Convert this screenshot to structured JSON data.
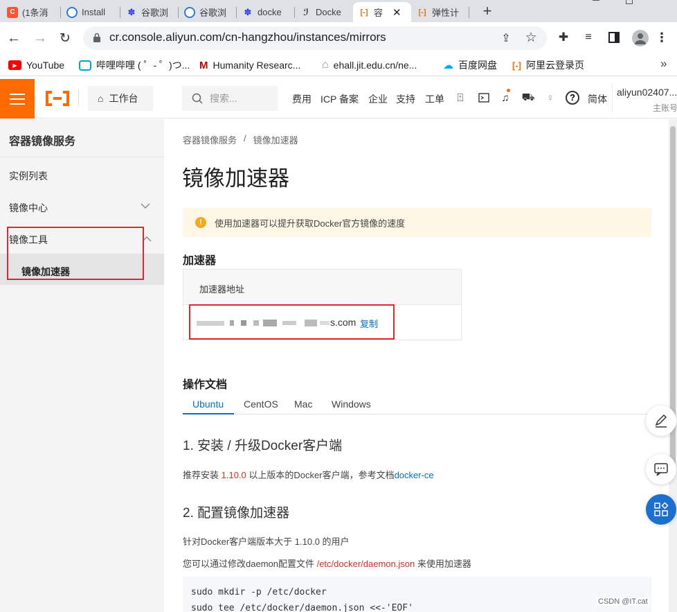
{
  "browser": {
    "tabs": [
      {
        "label": "(1条消",
        "favicon": "csdn-icon",
        "color": "#fc5531"
      },
      {
        "label": "Install",
        "favicon": "edge-icon",
        "color": "#2b7bd5"
      },
      {
        "label": "谷歌浏",
        "favicon": "baidu-paw-icon",
        "color": "#2932e1"
      },
      {
        "label": "谷歌浏",
        "favicon": "edge-icon",
        "color": "#2b7bd5"
      },
      {
        "label": "docke",
        "favicon": "baidu-paw-icon",
        "color": "#2932e1"
      },
      {
        "label": "Docke",
        "favicon": "scribble-icon",
        "color": "#444"
      },
      {
        "label": "容",
        "favicon": "aliyun-icon",
        "color": "#ff6a00"
      },
      {
        "label": "弹性计",
        "favicon": "aliyun-icon",
        "color": "#ff6a00"
      }
    ],
    "url": "cr.console.aliyun.com/cn-hangzhou/instances/mirrors",
    "bookmarks": [
      {
        "label": "YouTube",
        "icon": "youtube-icon"
      },
      {
        "label": "哔哩哔哩 ( ゜- ゜)つ...",
        "icon": "bilibili-icon"
      },
      {
        "label": "Humanity Researc...",
        "icon": "humanity-icon"
      },
      {
        "label": "ehall.jit.edu.cn/ne...",
        "icon": "campus-icon"
      },
      {
        "label": "百度网盘",
        "icon": "baidu-netdisk-icon"
      },
      {
        "label": "阿里云登录页",
        "icon": "aliyun-icon"
      }
    ],
    "bookmarks_more": "»",
    "new_tab": "+"
  },
  "topbar": {
    "workbench": "工作台",
    "search_placeholder": "搜索...",
    "nav": [
      "费用",
      "ICP 备案",
      "企业",
      "支持",
      "工单"
    ],
    "lang": "简体",
    "user_name": "aliyun02407...",
    "user_role": "主账号"
  },
  "sidebar": {
    "title": "容器镜像服务",
    "items": [
      {
        "label": "实例列表"
      },
      {
        "label": "镜像中心"
      },
      {
        "label": "镜像工具"
      },
      {
        "label": "镜像加速器"
      }
    ]
  },
  "main": {
    "breadcrumb": [
      "容器镜像服务",
      "/",
      "镜像加速器"
    ],
    "title": "镜像加速器",
    "notice": "使用加速器可以提升获取Docker官方镜像的速度",
    "accel_heading": "加速器",
    "table_header": "加速器地址",
    "address_suffix": "s.com",
    "copy": "复制",
    "docs_heading": "操作文档",
    "tabs": [
      "Ubuntu",
      "CentOS",
      "Mac",
      "Windows"
    ],
    "step1": "1. 安装 / 升级Docker客户端",
    "step1_text_a": "推荐安装 ",
    "step1_version": "1.10.0",
    "step1_text_b": " 以上版本的Docker客户端，参考文档",
    "step1_link": "docker-ce",
    "step2": "2. 配置镜像加速器",
    "step2_text": "针对Docker客户端版本大于 1.10.0 的用户",
    "step2_text2_a": "您可以通过修改daemon配置文件 ",
    "step2_path": "/etc/docker/daemon.json",
    "step2_text2_b": " 来使用加速器",
    "code": [
      "sudo mkdir -p /etc/docker",
      "sudo tee /etc/docker/daemon.json <<-'EOF'"
    ]
  },
  "watermark": "CSDN @IT.cat",
  "colors": {
    "brand": "#ff6a00",
    "link": "#0070cc",
    "highlight": "#d93026",
    "notice_bg": "#fff7e6"
  }
}
